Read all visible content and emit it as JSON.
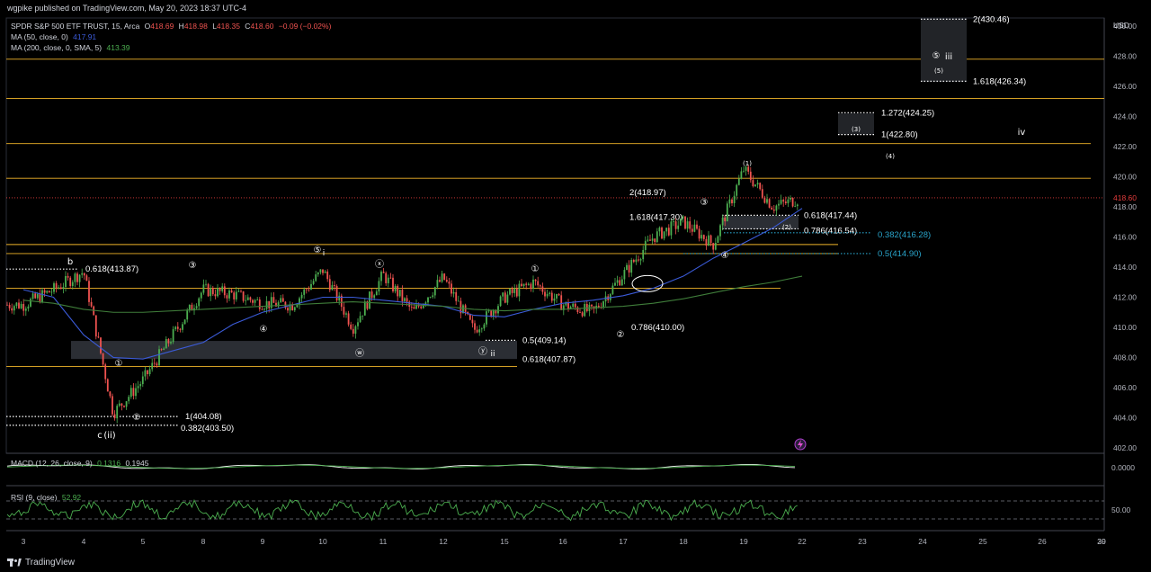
{
  "header": {
    "published": "wgpike published on TradingView.com, May 20, 2023 18:37 UTC-4"
  },
  "legend": {
    "symbol": "SPDR S&P 500 ETF TRUST, 15, Arca",
    "o_label": "O",
    "o_value": "418.69",
    "h_label": "H",
    "h_value": "418.98",
    "l_label": "L",
    "l_value": "418.35",
    "c_label": "C",
    "c_value": "418.60",
    "change": "−0.09 (−0.02%)",
    "ma50_label": "MA (50, close, 0)",
    "ma50_value": "417.91",
    "ma200_label": "MA (200, close, 0, SMA, 5)",
    "ma200_value": "413.39",
    "macd_label": "MACD (12, 26, close, 9)",
    "macd_value1": "0.1316",
    "macd_value2": "0.1945",
    "rsi_label": "RSI (9, close)",
    "rsi_value": "52.92"
  },
  "footer": {
    "brand": "TradingView"
  },
  "colors": {
    "up": "#26a69a",
    "candle_up": "#4caf50",
    "candle_down": "#ef5350",
    "level": "#f0b429",
    "ma50": "#3b5bd9",
    "ma200": "#3f7d3a",
    "cyan": "#29a3c9",
    "price_line": "#e23c3c"
  },
  "chart_data": {
    "type": "line",
    "title": "SPDR S&P 500 ETF TRUST, 15, Arca",
    "price_axis": {
      "currency": "USD",
      "ylim": [
        401.5,
        431.5
      ],
      "ticks": [
        402,
        404,
        406,
        408,
        410,
        412,
        414,
        416,
        418,
        420,
        422,
        424,
        426,
        428,
        430
      ],
      "last_price": "418.60"
    },
    "x_ticks": [
      "3",
      "4",
      "5",
      "8",
      "9",
      "10",
      "11",
      "12",
      "15",
      "16",
      "17",
      "18",
      "19",
      "22",
      "23",
      "24",
      "25",
      "26",
      "29",
      "30"
    ],
    "series": [
      {
        "name": "SPDR S&P 500 ETF TRUST",
        "x": [
          "3",
          "3.5",
          "4",
          "4.5",
          "5",
          "8",
          "8.5",
          "9",
          "9.5",
          "10",
          "10.5",
          "11",
          "11.5",
          "12",
          "12.5",
          "15",
          "15.5",
          "16",
          "16.5",
          "17",
          "17.5",
          "18",
          "18.5",
          "19",
          "19.5",
          "22"
        ],
        "values": [
          411.5,
          412.5,
          413.7,
          404.3,
          406.5,
          412.5,
          412.2,
          411.6,
          411.5,
          413.8,
          410.0,
          413.5,
          411.0,
          413.3,
          409.8,
          412.0,
          413.0,
          411.5,
          411.0,
          413.5,
          416.0,
          417.0,
          415.5,
          420.5,
          418.0,
          418.6
        ]
      },
      {
        "name": "MA (50, close, 0)",
        "values": [
          412.5,
          412.0,
          409.5,
          408.0,
          407.9,
          409.0,
          410.2,
          411.0,
          411.5,
          412.0,
          412.0,
          411.8,
          411.6,
          411.4,
          410.8,
          410.7,
          411.2,
          411.6,
          411.8,
          412.1,
          412.6,
          413.4,
          414.6,
          415.6,
          416.6,
          417.9
        ]
      },
      {
        "name": "MA (200, close, 0, SMA, 5)",
        "values": [
          411.8,
          411.6,
          411.2,
          411.0,
          411.0,
          411.2,
          411.3,
          411.4,
          411.5,
          411.6,
          411.7,
          411.6,
          411.5,
          411.4,
          411.2,
          411.1,
          411.2,
          411.2,
          411.3,
          411.4,
          411.6,
          411.9,
          412.3,
          412.7,
          413.0,
          413.4
        ]
      }
    ],
    "horizontal_levels": [
      427.8,
      425.2,
      422.2,
      419.9,
      415.5,
      414.9,
      412.6,
      407.4
    ],
    "fib_labels": [
      {
        "text": "2(430.46)",
        "price": 430.46
      },
      {
        "text": "1.618(426.34)",
        "price": 426.34
      },
      {
        "text": "1.272(424.25)",
        "price": 424.25
      },
      {
        "text": "1(422.80)",
        "price": 422.8
      },
      {
        "text": "2(418.97)",
        "price": 418.97
      },
      {
        "text": "1.618(417.30)",
        "price": 417.3
      },
      {
        "text": "0.618(417.44)",
        "price": 417.44
      },
      {
        "text": "0.786(416.54)",
        "price": 416.54
      },
      {
        "text": "0.382(416.28)",
        "price": 416.28
      },
      {
        "text": "0.5(414.90)",
        "price": 414.9
      },
      {
        "text": "0.618(413.87)",
        "price": 413.87
      },
      {
        "text": "0.786(410.00)",
        "price": 410.0
      },
      {
        "text": "0.5(409.14)",
        "price": 409.14
      },
      {
        "text": "0.618(407.87)",
        "price": 407.87
      },
      {
        "text": "1(404.08)",
        "price": 404.08
      },
      {
        "text": "0.382(403.50)",
        "price": 403.5
      }
    ],
    "wave_labels": [
      "b",
      "c",
      "(ii)",
      "i",
      "ii",
      "iii",
      "iv",
      "(1)",
      "(2)",
      "(3)",
      "(4)",
      "(5)",
      "③",
      "④",
      "⑤",
      "ⓧ",
      "ⓦ",
      "ⓨ",
      "①",
      "②"
    ],
    "macd": {
      "label": "MACD (12, 26, close, 9)",
      "macd": 0.1316,
      "signal": 0.1945,
      "tick": "0.0000"
    },
    "rsi": {
      "label": "RSI (9, close)",
      "value": 52.92,
      "tick": "50.00"
    }
  }
}
